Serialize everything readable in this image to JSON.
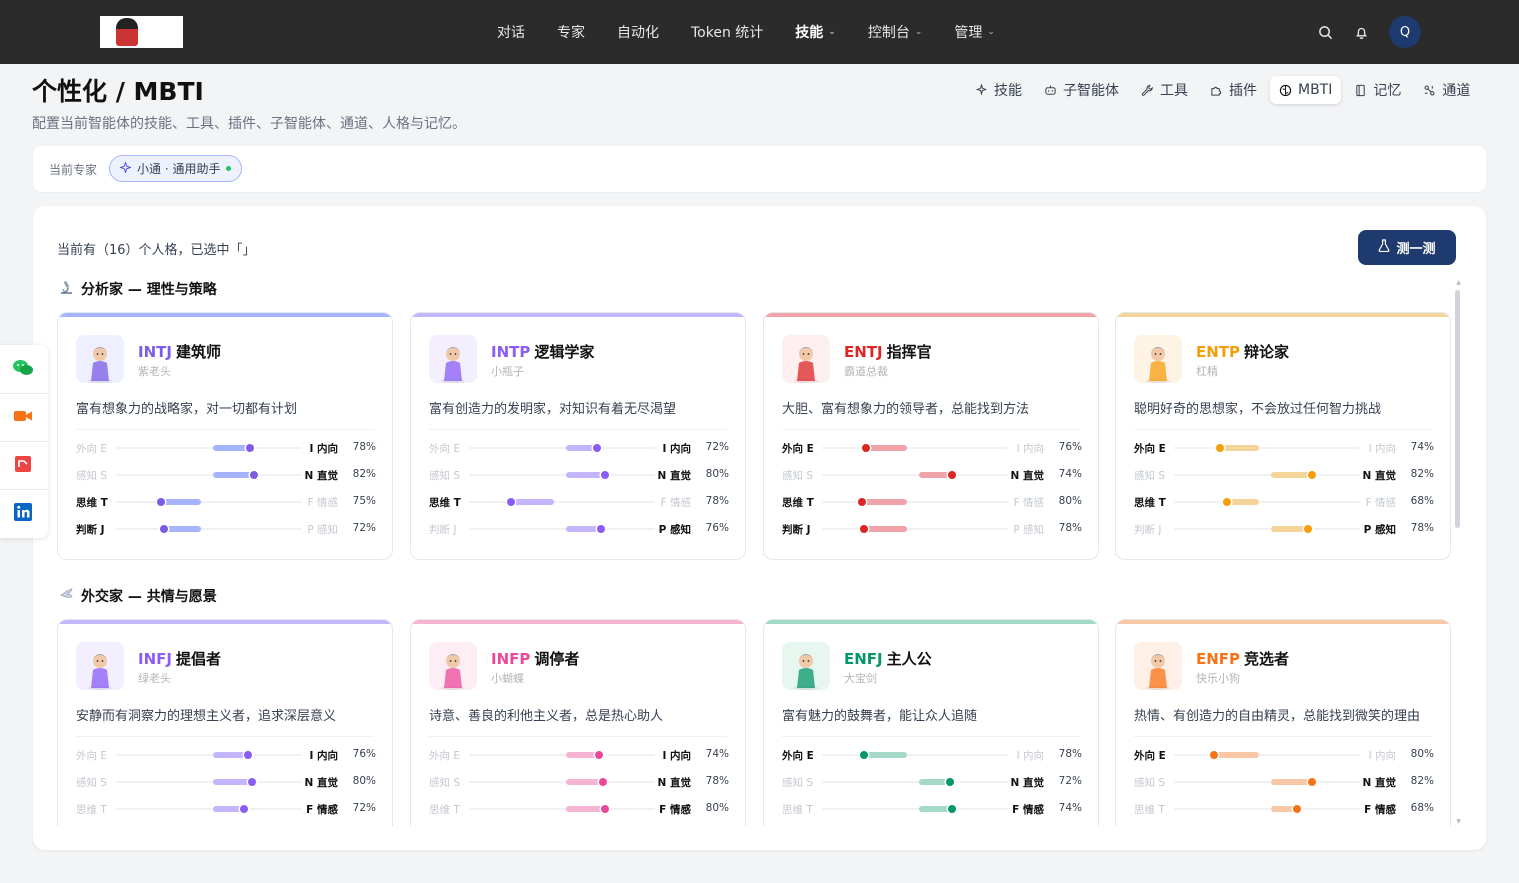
{
  "nav": {
    "items": [
      {
        "label": "对话",
        "caret": false,
        "active": false
      },
      {
        "label": "专家",
        "caret": false,
        "active": false
      },
      {
        "label": "自动化",
        "caret": false,
        "active": false
      },
      {
        "label": "Token 统计",
        "caret": false,
        "active": false
      },
      {
        "label": "技能",
        "caret": true,
        "active": true
      },
      {
        "label": "控制台",
        "caret": true,
        "active": false
      },
      {
        "label": "管理",
        "caret": true,
        "active": false
      }
    ],
    "avatar_letter": "Q"
  },
  "header": {
    "title": "个性化 / MBTI",
    "subtitle": "配置当前智能体的技能、工具、插件、子智能体、通道、人格与记忆。"
  },
  "tabs": [
    {
      "label": "技能",
      "icon": "sparkle-icon",
      "active": false
    },
    {
      "label": "子智能体",
      "icon": "robot-icon",
      "active": false
    },
    {
      "label": "工具",
      "icon": "wrench-icon",
      "active": false
    },
    {
      "label": "插件",
      "icon": "puzzle-icon",
      "active": false
    },
    {
      "label": "MBTI",
      "icon": "brain-icon",
      "active": true
    },
    {
      "label": "记忆",
      "icon": "notebook-icon",
      "active": false
    },
    {
      "label": "通道",
      "icon": "channel-icon",
      "active": false
    }
  ],
  "expert": {
    "label": "当前专家",
    "chip": "小通 · 通用助手"
  },
  "panel": {
    "count_text": "当前有（16）个人格，已选中「」",
    "test_button": "测一测"
  },
  "groups": [
    {
      "title": "分析家 — 理性与策略",
      "icon": "microscope-icon",
      "cards": [
        {
          "code": "INTJ",
          "name": "建筑师",
          "nick": "紫老头",
          "desc": "富有想象力的战略家，对一切都有计划",
          "color": "#7c5ce6",
          "tint": "#a5b4fc",
          "bg": "#eef0ff",
          "dims": [
            {
              "left": "外向 E",
              "right": "I 内向",
              "pct": "78%",
              "value": 0.78,
              "side": "right"
            },
            {
              "left": "感知 S",
              "right": "N 直觉",
              "pct": "82%",
              "value": 0.82,
              "side": "right"
            },
            {
              "left": "思维 T",
              "right": "F 情感",
              "pct": "75%",
              "value": 0.75,
              "side": "left"
            },
            {
              "left": "判断 J",
              "right": "P 感知",
              "pct": "72%",
              "value": 0.72,
              "side": "left"
            }
          ]
        },
        {
          "code": "INTP",
          "name": "逻辑学家",
          "nick": "小瓶子",
          "desc": "富有创造力的发明家，对知识有着无尽渴望",
          "color": "#8b5cf6",
          "tint": "#c4b5fd",
          "bg": "#f3efff",
          "dims": [
            {
              "left": "外向 E",
              "right": "I 内向",
              "pct": "72%",
              "value": 0.72,
              "side": "right"
            },
            {
              "left": "感知 S",
              "right": "N 直觉",
              "pct": "80%",
              "value": 0.8,
              "side": "right"
            },
            {
              "left": "思维 T",
              "right": "F 情感",
              "pct": "78%",
              "value": 0.78,
              "side": "left"
            },
            {
              "left": "判断 J",
              "right": "P 感知",
              "pct": "76%",
              "value": 0.76,
              "side": "right"
            }
          ]
        },
        {
          "code": "ENTJ",
          "name": "指挥官",
          "nick": "霸道总裁",
          "desc": "大胆、富有想象力的领导者，总能找到方法",
          "color": "#dc2626",
          "tint": "#f0a3a8",
          "bg": "#fdeef0",
          "dims": [
            {
              "left": "外向 E",
              "right": "I 内向",
              "pct": "76%",
              "value": 0.76,
              "side": "left"
            },
            {
              "left": "感知 S",
              "right": "N 直觉",
              "pct": "74%",
              "value": 0.74,
              "side": "right"
            },
            {
              "left": "思维 T",
              "right": "F 情感",
              "pct": "80%",
              "value": 0.8,
              "side": "left"
            },
            {
              "left": "判断 J",
              "right": "P 感知",
              "pct": "78%",
              "value": 0.78,
              "side": "left"
            }
          ]
        },
        {
          "code": "ENTP",
          "name": "辩论家",
          "nick": "杠精",
          "desc": "聪明好奇的思想家，不会放过任何智力挑战",
          "color": "#f59e0b",
          "tint": "#f5d49a",
          "bg": "#fdf4e6",
          "dims": [
            {
              "left": "外向 E",
              "right": "I 内向",
              "pct": "74%",
              "value": 0.74,
              "side": "left"
            },
            {
              "left": "感知 S",
              "right": "N 直觉",
              "pct": "82%",
              "value": 0.82,
              "side": "right"
            },
            {
              "left": "思维 T",
              "right": "F 情感",
              "pct": "68%",
              "value": 0.68,
              "side": "left"
            },
            {
              "left": "判断 J",
              "right": "P 感知",
              "pct": "78%",
              "value": 0.78,
              "side": "right"
            }
          ]
        }
      ]
    },
    {
      "title": "外交家 — 共情与愿景",
      "icon": "dove-icon",
      "cards": [
        {
          "code": "INFJ",
          "name": "提倡者",
          "nick": "绿老头",
          "desc": "安静而有洞察力的理想主义者，追求深层意义",
          "color": "#8b5cf6",
          "tint": "#c4b5fd",
          "bg": "#f3efff",
          "dims": [
            {
              "left": "外向 E",
              "right": "I 内向",
              "pct": "76%",
              "value": 0.76,
              "side": "right"
            },
            {
              "left": "感知 S",
              "right": "N 直觉",
              "pct": "80%",
              "value": 0.8,
              "side": "right"
            },
            {
              "left": "思维 T",
              "right": "F 情感",
              "pct": "72%",
              "value": 0.72,
              "side": "right"
            }
          ]
        },
        {
          "code": "INFP",
          "name": "调停者",
          "nick": "小蝴蝶",
          "desc": "诗意、善良的利他主义者，总是热心助人",
          "color": "#ec4899",
          "tint": "#f5b4d2",
          "bg": "#fdeef5",
          "dims": [
            {
              "left": "外向 E",
              "right": "I 内向",
              "pct": "74%",
              "value": 0.74,
              "side": "right"
            },
            {
              "left": "感知 S",
              "right": "N 直觉",
              "pct": "78%",
              "value": 0.78,
              "side": "right"
            },
            {
              "left": "思维 T",
              "right": "F 情感",
              "pct": "80%",
              "value": 0.8,
              "side": "right"
            }
          ]
        },
        {
          "code": "ENFJ",
          "name": "主人公",
          "nick": "大宝剑",
          "desc": "富有魅力的鼓舞者，能让众人追随",
          "color": "#059669",
          "tint": "#a3d9c5",
          "bg": "#e8f6f0",
          "dims": [
            {
              "left": "外向 E",
              "right": "I 内向",
              "pct": "78%",
              "value": 0.78,
              "side": "left"
            },
            {
              "left": "感知 S",
              "right": "N 直觉",
              "pct": "72%",
              "value": 0.72,
              "side": "right"
            },
            {
              "left": "思维 T",
              "right": "F 情感",
              "pct": "74%",
              "value": 0.74,
              "side": "right"
            }
          ]
        },
        {
          "code": "ENFP",
          "name": "竞选者",
          "nick": "快乐小狗",
          "desc": "热情、有创造力的自由精灵，总能找到微笑的理由",
          "color": "#f97316",
          "tint": "#f8c8a6",
          "bg": "#fef0e6",
          "dims": [
            {
              "left": "外向 E",
              "right": "I 内向",
              "pct": "80%",
              "value": 0.8,
              "side": "left"
            },
            {
              "left": "感知 S",
              "right": "N 直觉",
              "pct": "82%",
              "value": 0.82,
              "side": "right"
            },
            {
              "left": "思维 T",
              "right": "F 情感",
              "pct": "68%",
              "value": 0.68,
              "side": "right"
            }
          ]
        }
      ]
    }
  ],
  "social": [
    {
      "icon": "wechat-icon",
      "color": "#22c55e"
    },
    {
      "icon": "video-icon",
      "color": "#f97316"
    },
    {
      "icon": "red-note-icon",
      "color": "#ef4444"
    },
    {
      "icon": "linkedin-icon",
      "color": "#0a66c2"
    }
  ]
}
